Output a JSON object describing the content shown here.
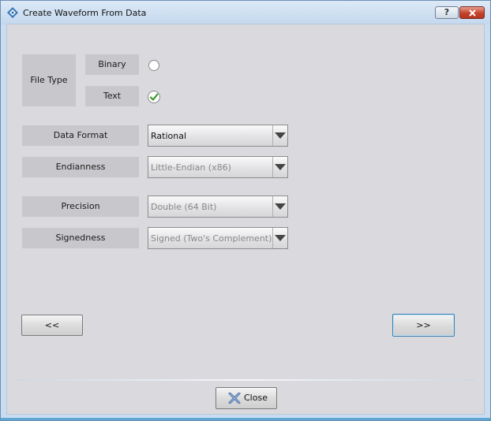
{
  "window": {
    "title": "Create Waveform From Data",
    "help_label": "?",
    "close_label": "Close"
  },
  "file_type": {
    "label": "File Type",
    "binary_label": "Binary",
    "text_label": "Text",
    "binary_checked": false,
    "text_checked": true
  },
  "data_format": {
    "label": "Data Format",
    "value": "Rational"
  },
  "endianness": {
    "label": "Endianness",
    "value": "Little-Endian (x86)"
  },
  "precision": {
    "label": "Precision",
    "value": "Double (64 Bit)"
  },
  "signedness": {
    "label": "Signedness",
    "value": "Signed (Two's Complement)"
  },
  "nav": {
    "back_label": "<<",
    "next_label": ">>"
  },
  "colors": {
    "accent": "#5fa8d3",
    "close_red": "#c5412a",
    "check_green": "#3a9a2a"
  }
}
